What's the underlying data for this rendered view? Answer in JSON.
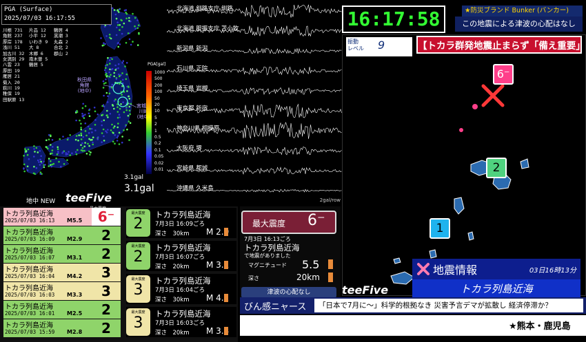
{
  "map_panel": {
    "title": "PGA (Surface)",
    "datetime": "2025/07/03 16:17:55",
    "stations": [
      [
        "川根 731",
        "片品 12",
        "鶴居 4"
      ],
      [
        "角館 237",
        "小平 12",
        "黒潮 3"
      ],
      [
        "厚岸 178",
        "いわき 9",
        "丸森 2"
      ],
      [
        "浅川 51",
        "大 8",
        "合北 2"
      ],
      [
        "加古川 32",
        "木郷 6",
        "郡山 2"
      ],
      [
        "女満別 29",
        "南木曽 5",
        ""
      ],
      [
        "八雲 23",
        "鶴居 5",
        ""
      ],
      [
        "厚田 19",
        "",
        ""
      ],
      [
        "雁居 21",
        "",
        ""
      ],
      [
        "菊入 20",
        "",
        ""
      ],
      [
        "萩川 19",
        "",
        ""
      ],
      [
        "稚保 19",
        "",
        ""
      ],
      [
        "田駅原 13",
        "",
        ""
      ]
    ],
    "scale_unit": "PGA[gal]",
    "scale_values": [
      "1000",
      "500",
      "200",
      "100",
      "50",
      "20",
      "10",
      "5",
      "2",
      "1",
      "0.5",
      "0.2",
      "0.1",
      "0.05",
      "0.02",
      "0.01"
    ],
    "callout_left": "秋田県\n角館\n(地中)",
    "callout_right": "宮城県\n川崎\n(地中)",
    "pga_small": "3.1gal",
    "pga_big": "3.1gal",
    "chichu_label": "地中 NEW",
    "brand": "teeFive"
  },
  "waves": {
    "labels": [
      "北海道 釧路支庁 釧路",
      "北海道 胆振支庁 苫小牧",
      "新潟県 新潟",
      "石川県 正院",
      "埼玉県 岩槻",
      "東京都 新宿",
      "神奈川県 相模原",
      "大阪府 堺",
      "宮崎県 都城",
      "沖縄県 久米島"
    ],
    "footer": "2gal/row"
  },
  "clock": "16:17:58",
  "bunker": "★防災ブランド Bunker (バンカー)",
  "tsunami_top": "この地震による津波の心配はなし",
  "shindo_level": {
    "label": "振動\nレベル",
    "value": "9"
  },
  "headline": "【トカラ群発地震止まらず「備え重要」",
  "map_markers": [
    "6⁻",
    "2",
    "1"
  ],
  "eq_list": [
    {
      "name": "トカラ列島近海",
      "date": "2025/07/03 16:13",
      "mag": "M5.5",
      "intensity": "6⁻",
      "color": "#f7c0c6"
    },
    {
      "name": "トカラ列島近海",
      "date": "2025/07/03 16:09",
      "mag": "M2.9",
      "intensity": "2",
      "color": "#8fd46a"
    },
    {
      "name": "トカラ列島近海",
      "date": "2025/07/03 16:07",
      "mag": "M3.1",
      "intensity": "2",
      "color": "#8fd46a"
    },
    {
      "name": "トカラ列島近海",
      "date": "2025/07/03 16:04",
      "mag": "M4.2",
      "intensity": "3",
      "color": "#f0e5a8"
    },
    {
      "name": "トカラ列島近海",
      "date": "2025/07/03 16:03",
      "mag": "M3.3",
      "intensity": "3",
      "color": "#f0e5a8"
    },
    {
      "name": "トカラ列島近海",
      "date": "2025/07/03 16:01",
      "mag": "M2.5",
      "intensity": "2",
      "color": "#8fd46a"
    },
    {
      "name": "トカラ列島近海",
      "date": "2025/07/03 15:59",
      "mag": "M2.8",
      "intensity": "2",
      "color": "#8fd46a"
    }
  ],
  "max_label_tag": "最大震度",
  "cards": [
    {
      "badge_label": "最大震度",
      "intensity": "2",
      "name": "トカラ列島近海",
      "time": "7月3日 16:09ごろ",
      "depth": "深さ　30km",
      "mag": "M 2.9",
      "bar_color": "#e88b3a",
      "badge_color": "#8fd46a"
    },
    {
      "badge_label": "最大震度",
      "intensity": "2",
      "name": "トカラ列島近海",
      "time": "7月3日 16:07ごろ",
      "depth": "深さ　20km",
      "mag": "M 3.1",
      "bar_color": "#e88b3a",
      "badge_color": "#8fd46a"
    },
    {
      "badge_label": "最大震度",
      "intensity": "3",
      "name": "トカラ列島近海",
      "time": "7月3日 16:04ごろ",
      "depth": "深さ　30km",
      "mag": "M 4.2",
      "bar_color": "#e88b3a",
      "badge_color": "#f0e5a8"
    },
    {
      "badge_label": "最大震度",
      "intensity": "3",
      "name": "トカラ列島近海",
      "time": "7月3日 16:03ごろ",
      "depth": "深さ　20km",
      "mag": "M 3.3",
      "bar_color": "#e88b3a",
      "badge_color": "#f0e5a8"
    }
  ],
  "detail": {
    "max_label": "最大震度",
    "max_value": "6⁻",
    "time": "7月3日 16:13ごろ",
    "name": "トカラ列島近海",
    "cond": "で地震がありました",
    "mag_label": "マグニチュード",
    "mag_value": "5.5",
    "depth_label": "深さ",
    "depth_value": "20km",
    "tsunami": "津波の心配なし"
  },
  "info": {
    "title": "地震情報",
    "date": "03日16時13分",
    "region": "トカラ列島近海"
  },
  "brand2": "teeFive",
  "news": {
    "label": "びん感ニャース",
    "text": "「日本で7月に〜」科学的根拠なき 災害予言デマが拡散し 経済停滞か？"
  },
  "ticker": "★熊本・鹿児島"
}
